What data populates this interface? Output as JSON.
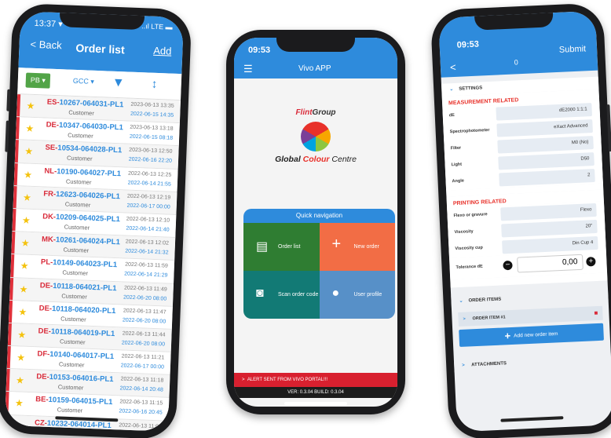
{
  "left_phone": {
    "status_time": "13:37 ▾",
    "status_right": "..ıl LTE ▬",
    "back_label": "< Back",
    "title": "Order list",
    "add_label": "Add",
    "filter_pb": "PB ▾",
    "filter_gcc": "GCC ▾",
    "orders": [
      {
        "prefix": "ES-",
        "id": "10267-064031-PL1",
        "customer": "Customer",
        "created": "2023-06-13 13:35",
        "due": "2022-06-15 14:35"
      },
      {
        "prefix": "DE-",
        "id": "10347-064030-PL1",
        "customer": "Customer",
        "created": "2023-06-13 13:18",
        "due": "2022-06-15 08:18"
      },
      {
        "prefix": "SE-",
        "id": "10534-064028-PL1",
        "customer": "Customer",
        "created": "2023-06-13 12:50",
        "due": "2022-06-16 22:20"
      },
      {
        "prefix": "NL-",
        "id": "10190-064027-PL1",
        "customer": "Customer",
        "created": "2022-06-13 12:25",
        "due": "2022-06-14 21:55"
      },
      {
        "prefix": "FR-",
        "id": "12623-064026-PL1",
        "customer": "Customer",
        "created": "2022-06-13 12:19",
        "due": "2022-06-17 00:00"
      },
      {
        "prefix": "DK-",
        "id": "10209-064025-PL1",
        "customer": "Customer",
        "created": "2022-06-13 12:10",
        "due": "2022-06-14 21:40"
      },
      {
        "prefix": "MK-",
        "id": "10261-064024-PL1",
        "customer": "Customer",
        "created": "2022-06-13 12:02",
        "due": "2022-06-14 21:32"
      },
      {
        "prefix": "PL-",
        "id": "10149-064023-PL1",
        "customer": "Customer",
        "created": "2022-06-13 11:59",
        "due": "2022-06-14 21:29"
      },
      {
        "prefix": "DE-",
        "id": "10118-064021-PL1",
        "customer": "Customer",
        "created": "2022-06-13 11:49",
        "due": "2022-06-20 08:00"
      },
      {
        "prefix": "DE-",
        "id": "10118-064020-PL1",
        "customer": "Customer",
        "created": "2022-06-13 11:47",
        "due": "2022-06-20 08:00"
      },
      {
        "prefix": "DE-",
        "id": "10118-064019-PL1",
        "customer": "Customer",
        "created": "2022-06-13 11:44",
        "due": "2022-06-20 08:00"
      },
      {
        "prefix": "DF-",
        "id": "10140-064017-PL1",
        "customer": "Customer",
        "created": "2022-06-13 11:21",
        "due": "2022-06-17 00:00"
      },
      {
        "prefix": "DE-",
        "id": "10153-064016-PL1",
        "customer": "Customer",
        "created": "2022-06-13 11:18",
        "due": "2022-06-14 20:48"
      },
      {
        "prefix": "BE-",
        "id": "10159-064015-PL1",
        "customer": "Customer",
        "created": "2022-06-13 11:15",
        "due": "2022-06-16 20:45"
      },
      {
        "prefix": "CZ-",
        "id": "10232-064014-PL1",
        "customer": "Customer",
        "created": "2022-06-13 11:05",
        "due": ""
      }
    ]
  },
  "middle_phone": {
    "status_time": "09:53",
    "title": "Vivo APP",
    "brand_flint": "Flint",
    "brand_group": "Group",
    "brand_gcc_1": "Global ",
    "brand_gcc_2": "Colour",
    "brand_gcc_3": " Centre",
    "quick_nav_title": "Quick navigation",
    "tiles": {
      "order_list": "Order list",
      "new_order": "New order",
      "scan": "Scan order code",
      "profile": "User profile"
    },
    "alert": "ALERT SENT FROM VIVO PORTAL!!!",
    "version": "VER: 0.3.04  BUILD: 0.3.04"
  },
  "right_phone": {
    "status_time": "09:53",
    "submit_label": "Submit",
    "order_number": "0",
    "settings_label": "SETTINGS",
    "measurement_label": "MEASUREMENT RELATED",
    "measurement_fields": [
      {
        "label": "dE",
        "value": "dE2000 1:1:1"
      },
      {
        "label": "Spectrophotometer",
        "value": "eXact Advanced"
      },
      {
        "label": "Filter",
        "value": "M0 (No)"
      },
      {
        "label": "Light",
        "value": "D50"
      },
      {
        "label": "Angle",
        "value": "2"
      }
    ],
    "printing_label": "PRINTING RELATED",
    "printing_fields": [
      {
        "label": "Flexo or gravure",
        "value": "Flexo"
      },
      {
        "label": "Viscosity",
        "value": "20\""
      },
      {
        "label": "Viscosity cup",
        "value": "Din Cup 4"
      }
    ],
    "tolerance_label": "Tolerance dE",
    "tolerance_value": "0,00",
    "order_items_label": "ORDER ITEMS",
    "order_item_label": "ORDER ITEM #1",
    "add_item_label": "Add new order item",
    "attachments_label": "ATTACHMENTS"
  },
  "colors": {
    "accent": "#2e8bdc",
    "alert": "#d8202f",
    "tile_order_list": "#2f7d32",
    "tile_new_order": "#f26d45",
    "tile_scan": "#127a75",
    "tile_profile": "#5790c8"
  }
}
